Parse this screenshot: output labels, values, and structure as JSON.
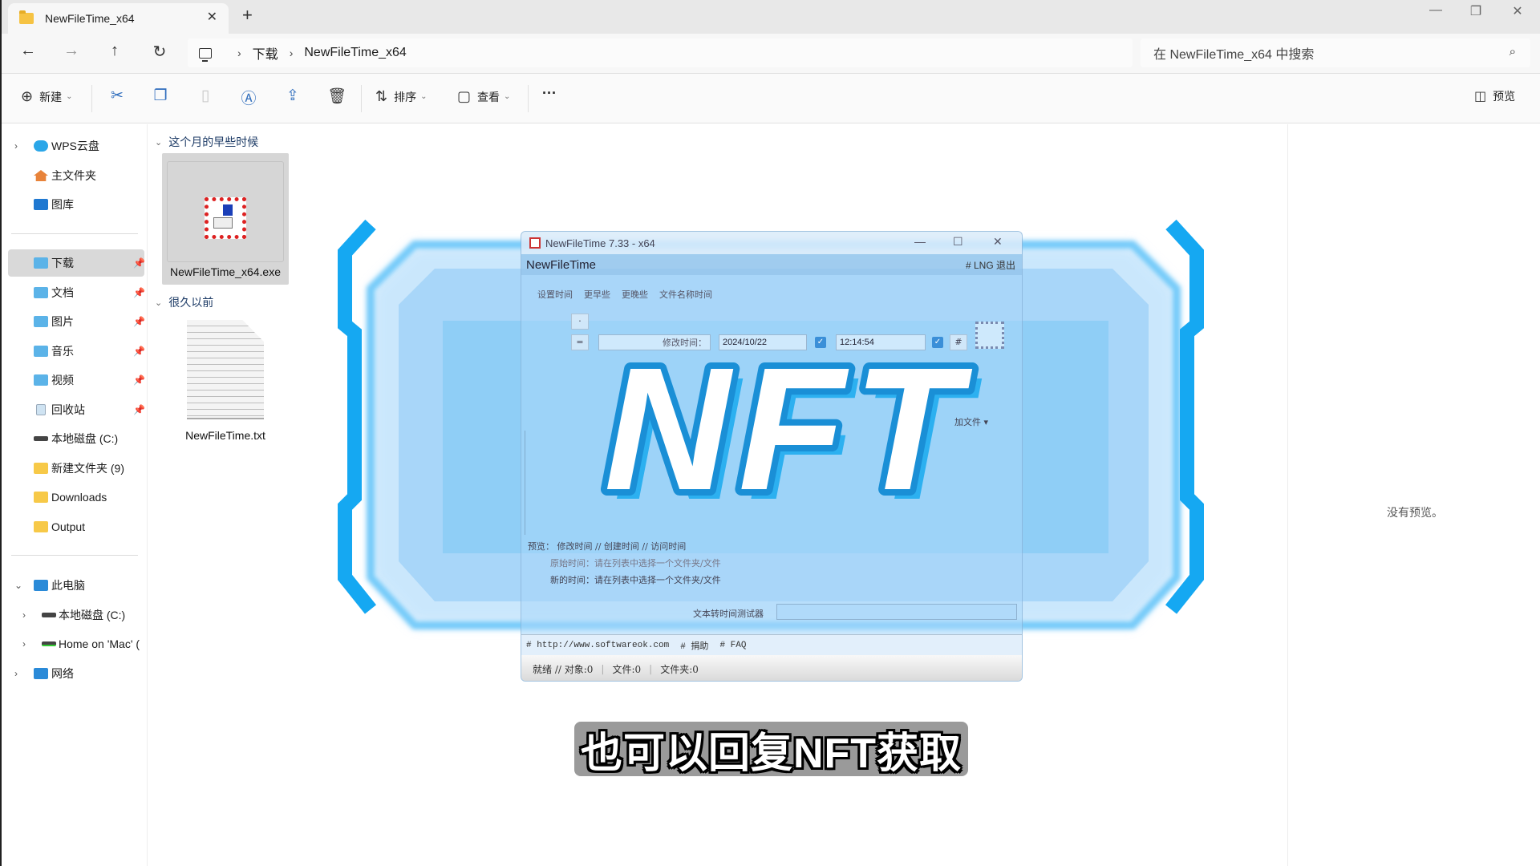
{
  "window": {
    "tab_title": "NewFileTime_x64",
    "tab_close": "✕",
    "new_tab": "+",
    "controls": {
      "minimize": "—",
      "maximize": "❐",
      "close": "✕"
    }
  },
  "nav": {
    "back": "←",
    "forward": "→",
    "up": "↑",
    "refresh": "↻",
    "breadcrumb": [
      "下载",
      "NewFileTime_x64"
    ],
    "breadcrumb_sep": "›",
    "search_placeholder": "在 NewFileTime_x64 中搜索",
    "search_icon": "⌕"
  },
  "toolbar": {
    "new_label": "新建",
    "sort_label": "排序",
    "view_label": "查看",
    "more": "···",
    "preview_label": "预览",
    "icons": [
      "cut-icon",
      "copy-icon",
      "paste-icon",
      "rename-icon",
      "share-icon",
      "delete-icon"
    ]
  },
  "sidebar": {
    "quick": [
      {
        "label": "WPS云盘",
        "icon": "cloud-icon",
        "expandable": true
      },
      {
        "label": "主文件夹",
        "icon": "home-icon"
      },
      {
        "label": "图库",
        "icon": "gallery-icon"
      }
    ],
    "pinned": [
      {
        "label": "下载",
        "icon": "downloads-folder-icon",
        "pinned": true,
        "selected": true
      },
      {
        "label": "文档",
        "icon": "documents-folder-icon",
        "pinned": true
      },
      {
        "label": "图片",
        "icon": "pictures-folder-icon",
        "pinned": true
      },
      {
        "label": "音乐",
        "icon": "music-folder-icon",
        "pinned": true
      },
      {
        "label": "视频",
        "icon": "videos-folder-icon",
        "pinned": true
      },
      {
        "label": "回收站",
        "icon": "recycle-bin-icon",
        "pinned": true
      },
      {
        "label": "本地磁盘 (C:)",
        "icon": "drive-icon"
      },
      {
        "label": "新建文件夹 (9)",
        "icon": "folder-icon"
      },
      {
        "label": "Downloads",
        "icon": "folder-icon"
      },
      {
        "label": "Output",
        "icon": "folder-icon"
      }
    ],
    "tree": [
      {
        "label": "此电脑",
        "icon": "computer-icon",
        "expanded": true
      },
      {
        "label": "本地磁盘 (C:)",
        "icon": "drive-icon",
        "child": true
      },
      {
        "label": "Home on 'Mac' (",
        "icon": "network-drive-icon",
        "child": true
      },
      {
        "label": "网络",
        "icon": "network-icon"
      }
    ]
  },
  "files": {
    "groups": [
      {
        "header": "这个月的早些时候",
        "items": [
          {
            "name": "NewFileTime_x64.exe",
            "type": "exe",
            "selected": true
          }
        ]
      },
      {
        "header": "很久以前",
        "items": [
          {
            "name": "NewFileTime.txt",
            "type": "txt"
          }
        ]
      }
    ]
  },
  "preview": {
    "message": "没有预览。"
  },
  "overlay_app": {
    "window_title": "NewFileTime 7.33 - x64",
    "app_header": "NewFileTime",
    "header_links": "# LNG 退出",
    "tabs": [
      "设置时间",
      "更早些",
      "更晚些",
      "文件名称时间"
    ],
    "modified_label": "修改时间：",
    "date_value": "2024/10/22",
    "time_value": "12:14:54",
    "hash_btn": "#",
    "add_files": "加文件 ▾",
    "preview_line": "预览：  修改时间  //  创建时间  //  访问时间",
    "original_time": "原始时间：请在列表中选择一个文件夹/文件",
    "new_time": "新的时间：请在列表中选择一个文件夹/文件",
    "text_tester": "文本转时间测试器",
    "links": [
      "# http://www.softwareok.com",
      "# 捐助",
      "# FAQ"
    ],
    "status": [
      "就绪 // 对象:0",
      "文件:0",
      "文件夹:0"
    ]
  },
  "overlay_badge": {
    "text": "NFT",
    "color": "#1a9be0"
  },
  "caption": {
    "text": "也可以回复NFT获取"
  }
}
